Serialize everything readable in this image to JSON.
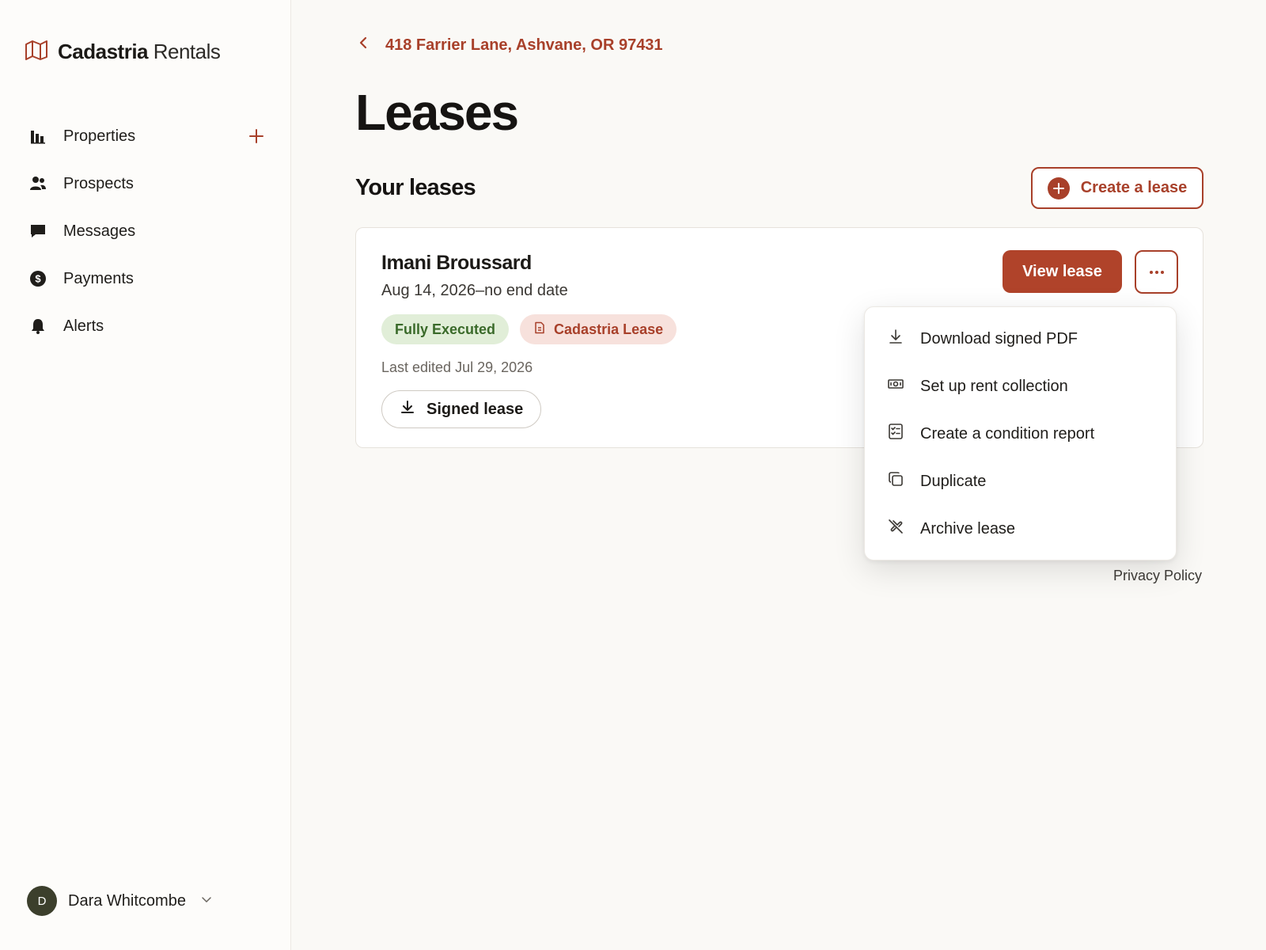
{
  "brand": {
    "name_strong": "Cadastria",
    "name_light": "Rentals",
    "logo_icon": "map-icon"
  },
  "sidebar": {
    "items": [
      {
        "label": "Properties",
        "icon": "bar-chart-icon",
        "has_add": true
      },
      {
        "label": "Prospects",
        "icon": "people-icon"
      },
      {
        "label": "Messages",
        "icon": "chat-icon"
      },
      {
        "label": "Payments",
        "icon": "dollar-icon"
      },
      {
        "label": "Alerts",
        "icon": "bell-icon"
      }
    ],
    "user": {
      "initial": "D",
      "name": "Dara Whitcombe"
    }
  },
  "header": {
    "breadcrumb": "418 Farrier Lane, Ashvane, OR 97431",
    "title": "Leases"
  },
  "section": {
    "title": "Your leases",
    "create_label": "Create a lease"
  },
  "lease": {
    "tenant": "Imani Broussard",
    "dates": "Aug 14, 2026–no end date",
    "status_badge": "Fully Executed",
    "type_badge": "Cadastria Lease",
    "last_edited": "Last edited Jul 29, 2026",
    "signed_button": "Signed lease",
    "view_button": "View lease"
  },
  "menu": {
    "items": [
      {
        "label": "Download signed PDF",
        "icon": "download-icon"
      },
      {
        "label": "Set up rent collection",
        "icon": "money-icon"
      },
      {
        "label": "Create a condition report",
        "icon": "checklist-icon"
      },
      {
        "label": "Duplicate",
        "icon": "duplicate-icon"
      },
      {
        "label": "Archive lease",
        "icon": "archive-icon"
      }
    ]
  },
  "footer": {
    "privacy": "Privacy Policy"
  },
  "colors": {
    "accent": "#a8402a",
    "success_bg": "#e1eed8",
    "success_fg": "#3a6a2a",
    "background": "#faf9f6"
  }
}
